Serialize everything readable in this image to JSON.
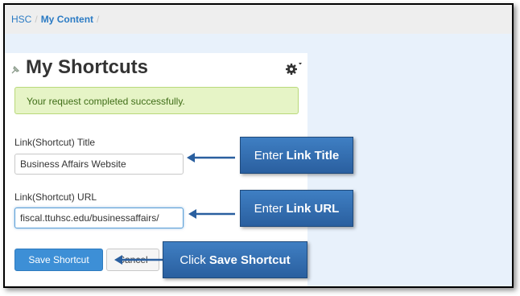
{
  "breadcrumb": {
    "root": "HSC",
    "current": "My Content",
    "separator": "/"
  },
  "page": {
    "title": "My Shortcuts"
  },
  "alert": {
    "message": "Your request completed successfully."
  },
  "form": {
    "title_label": "Link(Shortcut) Title",
    "title_value": "Business Affairs Website",
    "url_label": "Link(Shortcut) URL",
    "url_value": "fiscal.ttuhsc.edu/businessaffairs/",
    "save_label": "Save Shortcut",
    "cancel_label": "Cancel"
  },
  "callouts": {
    "title": {
      "prefix": "Enter",
      "emphasis": "Link Title"
    },
    "url": {
      "prefix": "Enter",
      "emphasis": "Link URL"
    },
    "save": {
      "prefix": "Click",
      "emphasis": "Save Shortcut"
    }
  },
  "icons": {
    "pin": "pin-icon",
    "gear": "gear-icon",
    "arrow": "arrow-left-icon"
  },
  "colors": {
    "primary": "#3d8fd6",
    "callout": "#2f68ab",
    "success_bg": "#e6f4c6",
    "success_text": "#3f6d17"
  }
}
